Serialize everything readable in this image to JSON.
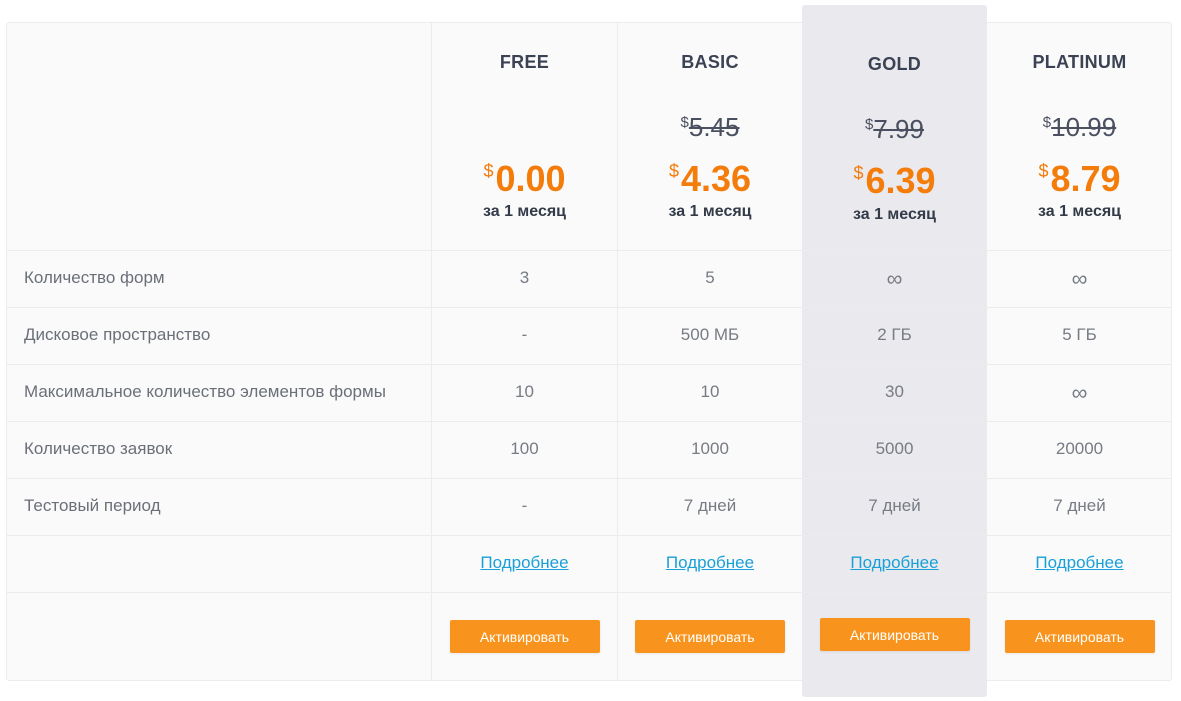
{
  "plans": [
    {
      "name": "FREE",
      "old_price": "",
      "currency": "$",
      "price": "0.00",
      "period": "за 1 месяц",
      "values": [
        "3",
        "-",
        "10",
        "100",
        "-"
      ],
      "more": "Подробнее",
      "button": "Активировать"
    },
    {
      "name": "BASIC",
      "old_price": "5.45",
      "currency": "$",
      "price": "4.36",
      "period": "за 1 месяц",
      "values": [
        "5",
        "500 МБ",
        "10",
        "1000",
        "7 дней"
      ],
      "more": "Подробнее",
      "button": "Активировать"
    },
    {
      "name": "GOLD",
      "old_price": "7.99",
      "currency": "$",
      "price": "6.39",
      "period": "за 1 месяц",
      "values": [
        "∞",
        "2 ГБ",
        "30",
        "5000",
        "7 дней"
      ],
      "more": "Подробнее",
      "button": "Активировать",
      "highlighted": true
    },
    {
      "name": "PLATINUM",
      "old_price": "10.99",
      "currency": "$",
      "price": "8.79",
      "period": "за 1 месяц",
      "values": [
        "∞",
        "5 ГБ",
        "∞",
        "20000",
        "7 дней"
      ],
      "more": "Подробнее",
      "button": "Активировать"
    }
  ],
  "features": [
    "Количество форм",
    "Дисковое пространство",
    "Максимальное количество элементов формы",
    "Количество заявок",
    "Тестовый период"
  ],
  "colors": {
    "accent": "#f47c0b",
    "button": "#f8941d",
    "link": "#1aa0d8",
    "highlight_column": "#eaeaee"
  }
}
